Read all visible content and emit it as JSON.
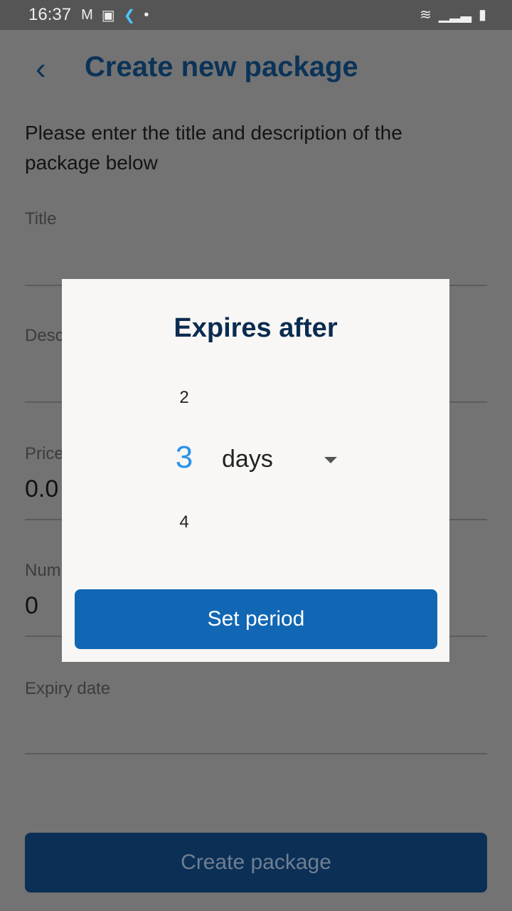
{
  "status_bar": {
    "time": "16:37"
  },
  "header": {
    "back_icon": "chevron-left-icon",
    "title": "Create new package"
  },
  "intro": "Please enter the title and description of the package below",
  "fields": [
    {
      "label": "Title",
      "value": ""
    },
    {
      "label": "Desc",
      "value": ""
    },
    {
      "label": "Price",
      "value": "0.0"
    },
    {
      "label": "Num",
      "value": "0"
    },
    {
      "label": "Expiry date",
      "value": ""
    }
  ],
  "create_button": "Create package",
  "dialog": {
    "title": "Expires after",
    "prev": "2",
    "selected": "3",
    "next": "4",
    "unit": "days",
    "set_button": "Set period"
  }
}
